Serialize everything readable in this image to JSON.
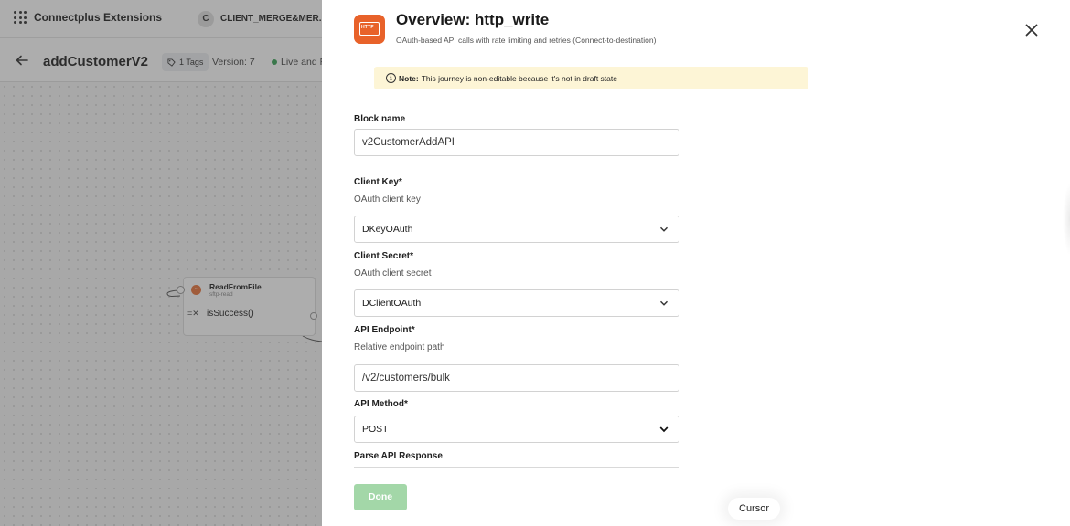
{
  "background": {
    "brand": "Connectplus Extensions",
    "org_initial": "C",
    "org_name": "CLIENT_MERGE&MER...",
    "journey_title": "addCustomerV2",
    "tags_label": "1 Tags",
    "version_label": "Version: 7",
    "status_label": "Live and R",
    "node": {
      "title": "ReadFromFile",
      "subtitle": "sftp-read",
      "rule": "isSuccess()"
    }
  },
  "drawer": {
    "title": "Overview: http_write",
    "subtitle": "OAuth-based API calls with rate limiting and retries (Connect-to-destination)",
    "icon_label": "HTTP",
    "note_label": "Note:",
    "note_text": "This journey is non-editable because it's not in draft state",
    "fields": {
      "block_name": {
        "label": "Block name",
        "value": "v2CustomerAddAPI"
      },
      "client_key": {
        "label": "Client Key*",
        "hint": "OAuth client key",
        "value": "DKeyOAuth"
      },
      "client_secret": {
        "label": "Client Secret*",
        "hint": "OAuth client secret",
        "value": "DClientOAuth"
      },
      "api_endpoint": {
        "label": "API Endpoint*",
        "hint": "Relative endpoint path",
        "value": "/v2/customers/bulk"
      },
      "api_method": {
        "label": "API Method*",
        "value": "POST"
      },
      "parse_response": {
        "label": "Parse API Response"
      }
    },
    "done_label": "Done",
    "cursor_label": "Cursor"
  },
  "colors": {
    "accent_orange": "#e8622a",
    "done_disabled": "#a3d7a8",
    "note_bg": "#fdf5d6",
    "status_green": "#3aa356"
  }
}
